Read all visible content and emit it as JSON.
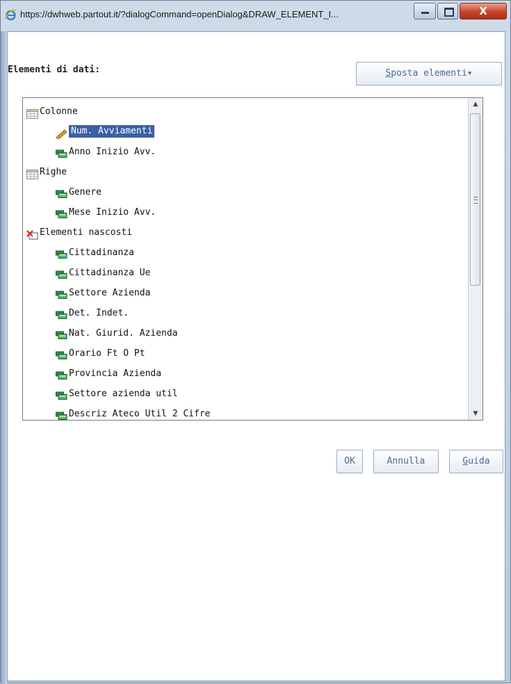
{
  "window": {
    "title": "https://dwhweb.partout.it/?dialogCommand=openDialog&DRAW_ELEMENT_I...",
    "close_glyph": "X"
  },
  "dialog": {
    "data_items_label": "Elementi di dati:",
    "move_button": {
      "underlined": "S",
      "rest": "posta elementi",
      "arrow": "▾"
    },
    "tree": [
      {
        "label": "Colonne",
        "level": 0,
        "icon": "table-icon"
      },
      {
        "label": "Num. Avviamenti",
        "level": 1,
        "icon": "ruler-measure-icon",
        "selected": true
      },
      {
        "label": "Anno Inizio Avv.",
        "level": 1,
        "icon": "category-icon"
      },
      {
        "label": "Righe",
        "level": 0,
        "icon": "table-icon"
      },
      {
        "label": "Genere",
        "level": 1,
        "icon": "category-icon"
      },
      {
        "label": "Mese Inizio Avv.",
        "level": 1,
        "icon": "category-icon"
      },
      {
        "label": "Elementi nascosti",
        "level": 0,
        "icon": "hidden-items-icon"
      },
      {
        "label": "Cittadinanza",
        "level": 1,
        "icon": "category-icon"
      },
      {
        "label": "Cittadinanza Ue",
        "level": 1,
        "icon": "category-icon"
      },
      {
        "label": "Settore Azienda",
        "level": 1,
        "icon": "category-icon"
      },
      {
        "label": "Det. Indet.",
        "level": 1,
        "icon": "category-icon"
      },
      {
        "label": "Nat. Giurid. Azienda",
        "level": 1,
        "icon": "category-icon"
      },
      {
        "label": "Orario Ft O Pt",
        "level": 1,
        "icon": "category-icon"
      },
      {
        "label": "Provincia Azienda",
        "level": 1,
        "icon": "category-icon"
      },
      {
        "label": "Settore azienda util",
        "level": 1,
        "icon": "category-icon"
      },
      {
        "label": "Descriz Ateco Util 2 Cifre",
        "level": 1,
        "icon": "category-icon"
      }
    ],
    "ok_label": "OK",
    "cancel_label": "Annulla",
    "help_button": {
      "underlined": "G",
      "rest": "uida"
    }
  },
  "colors": {
    "selection": "#3a5fa6",
    "button_text": "#4b6b8d",
    "close_button": "#c7432a"
  }
}
